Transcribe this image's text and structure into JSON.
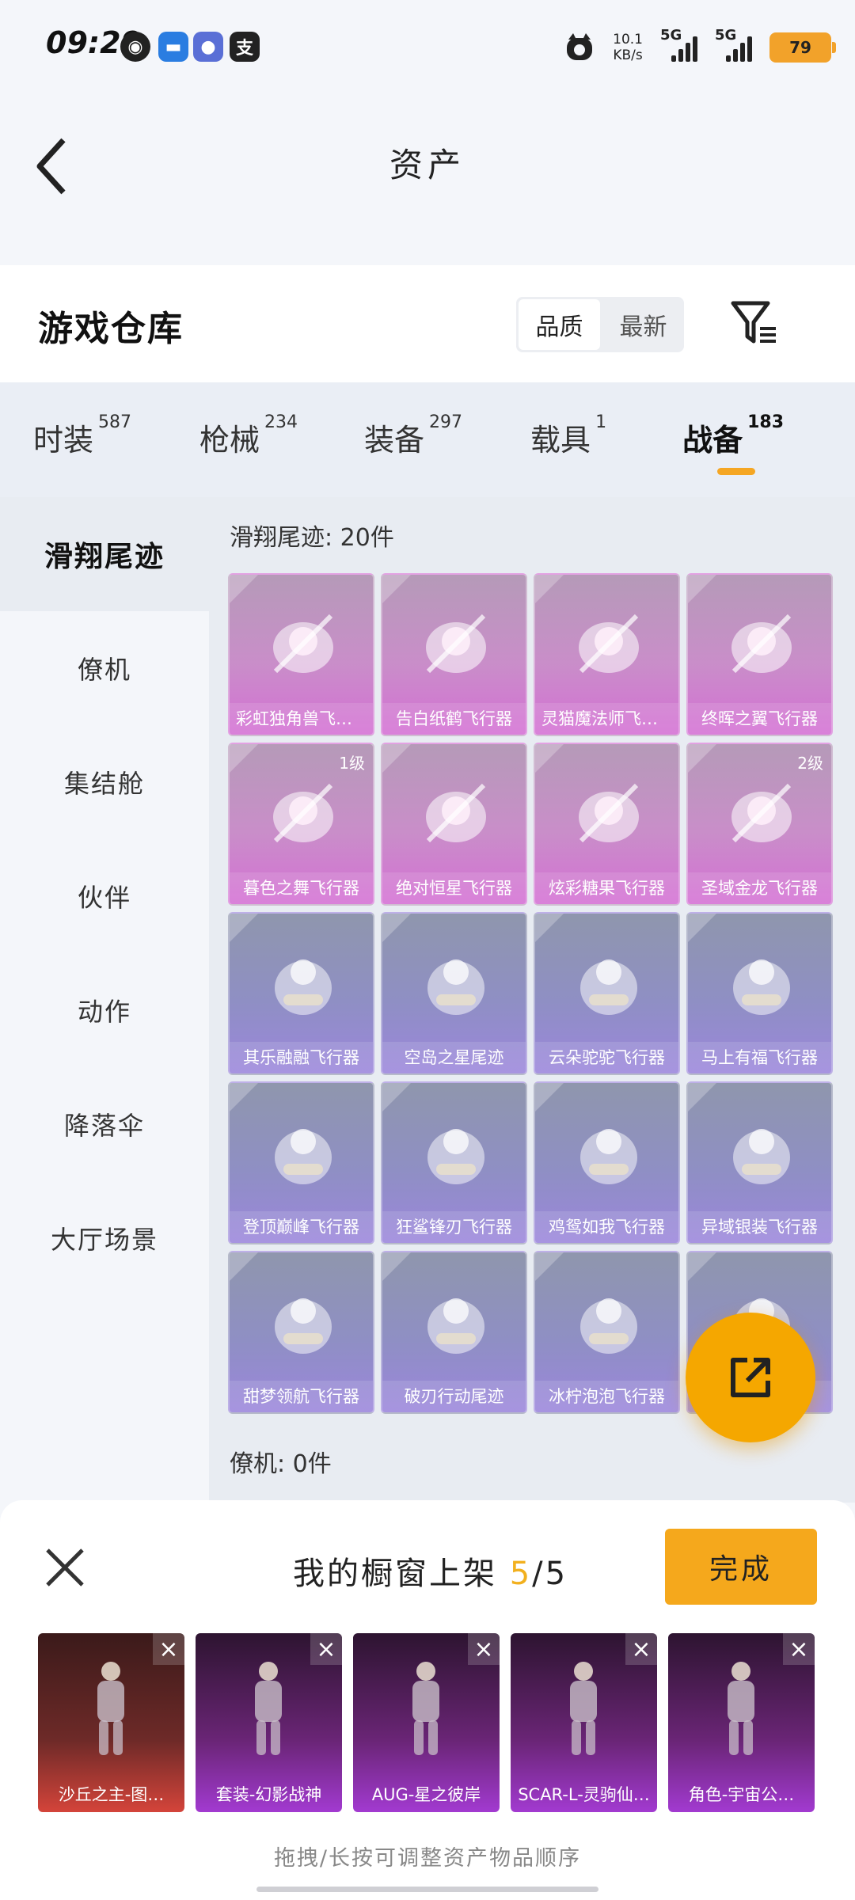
{
  "status_bar": {
    "time": "09:29",
    "net_speed_value": "10.1",
    "net_speed_unit": "KB/s",
    "sim1": "5G",
    "sim2": "5G",
    "battery": "79"
  },
  "nav": {
    "title": "资产"
  },
  "warehouse": {
    "title": "游戏仓库",
    "sort_options": [
      "品质",
      "最新"
    ],
    "sort_active": 0
  },
  "tabs": [
    {
      "label": "时装",
      "count": "587"
    },
    {
      "label": "枪械",
      "count": "234"
    },
    {
      "label": "装备",
      "count": "297"
    },
    {
      "label": "载具",
      "count": "1"
    },
    {
      "label": "战备",
      "count": "183",
      "active": true
    }
  ],
  "side_menu": [
    "滑翔尾迹",
    "僚机",
    "集结舱",
    "伙伴",
    "动作",
    "降落伞",
    "大厅场景"
  ],
  "sections": [
    {
      "label": "滑翔尾迹: 20件"
    },
    {
      "label": "僚机: 0件"
    }
  ],
  "items": [
    {
      "name": "彩虹独角兽飞行器",
      "style": "pink",
      "level": "",
      "icon": "unicorn-glider-icon"
    },
    {
      "name": "告白纸鹤飞行器",
      "style": "pink",
      "level": "",
      "icon": "paper-crane-icon"
    },
    {
      "name": "灵猫魔法师飞行器",
      "style": "pink",
      "level": "",
      "icon": "magic-cat-icon"
    },
    {
      "name": "终晖之翼飞行器",
      "style": "pink",
      "level": "",
      "icon": "wings-icon"
    },
    {
      "name": "暮色之舞飞行器",
      "style": "pink",
      "level": "1级",
      "icon": "twilight-dance-icon"
    },
    {
      "name": "绝对恒星飞行器",
      "style": "pink",
      "level": "",
      "icon": "planet-icon"
    },
    {
      "name": "炫彩糖果飞行器",
      "style": "pink",
      "level": "",
      "icon": "candy-icon"
    },
    {
      "name": "圣域金龙飞行器",
      "style": "pink",
      "level": "2级",
      "icon": "golden-dragon-icon"
    },
    {
      "name": "其乐融融飞行器",
      "style": "purple",
      "level": "",
      "icon": "penguin-balloon-icon"
    },
    {
      "name": "空岛之星尾迹",
      "style": "purple",
      "level": "",
      "icon": "rainbow-trail-icon"
    },
    {
      "name": "云朵驼驼飞行器",
      "style": "purple",
      "level": "",
      "icon": "alpaca-icon"
    },
    {
      "name": "马上有福飞行器",
      "style": "purple",
      "level": "",
      "icon": "horse-icon"
    },
    {
      "name": "登顶巅峰飞行器",
      "style": "purple",
      "level": "",
      "icon": "jet-pack-icon"
    },
    {
      "name": "狂鲨锋刃飞行器",
      "style": "purple",
      "level": "",
      "icon": "shark-icon"
    },
    {
      "name": "鸡鸳如我飞行器",
      "style": "purple",
      "level": "",
      "icon": "chicken-icon"
    },
    {
      "name": "异域银装飞行器",
      "style": "purple",
      "level": "",
      "icon": "silver-wing-icon"
    },
    {
      "name": "甜梦领航飞行器",
      "style": "purple",
      "level": "",
      "icon": "ufo-icon"
    },
    {
      "name": "破刃行动尾迹",
      "style": "purple",
      "level": "",
      "icon": "rainbow-trail-icon"
    },
    {
      "name": "冰柠泡泡飞行器",
      "style": "purple",
      "level": "",
      "icon": "glider-plane-icon"
    },
    {
      "name": "",
      "style": "purple",
      "level": "",
      "icon": "trail-icon"
    }
  ],
  "shelf": {
    "title_prefix": "我的橱窗上架",
    "count": "5",
    "total": "/5",
    "done_label": "完成",
    "hint": "拖拽/长按可调整资产物品顺序",
    "items": [
      {
        "name": "沙丘之主-图…",
        "style": "red",
        "icon": "mummy-character-icon"
      },
      {
        "name": "套装-幻影战神",
        "style": "vio",
        "icon": "armored-character-icon"
      },
      {
        "name": "AUG-星之彼岸",
        "style": "vio",
        "icon": "rifle-icon"
      },
      {
        "name": "SCAR-L-灵驹仙…",
        "style": "vio",
        "icon": "white-rifle-icon"
      },
      {
        "name": "角色-宇宙公…",
        "style": "vio",
        "icon": "princess-character-icon"
      }
    ]
  },
  "colors": {
    "accent": "#f5a623",
    "pink_card": "#d46fd4",
    "purple_card": "#9b86dc"
  }
}
